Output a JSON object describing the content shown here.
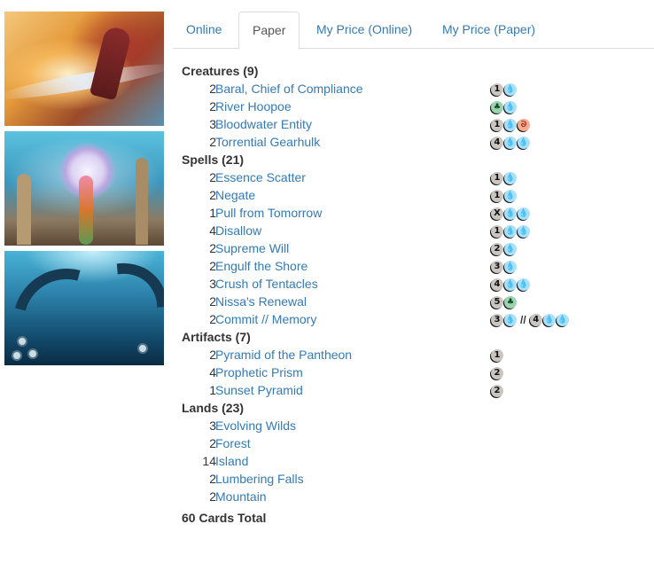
{
  "tabs": [
    {
      "label": "Online",
      "active": false
    },
    {
      "label": "Paper",
      "active": true
    },
    {
      "label": "My Price (Online)",
      "active": false
    },
    {
      "label": "My Price (Paper)",
      "active": false
    }
  ],
  "art": [
    {
      "subject": "red-robed mage casting fire"
    },
    {
      "subject": "glowing orb over city"
    },
    {
      "subject": "giant tentacles under water"
    }
  ],
  "sections": [
    {
      "heading": "Creatures (9)",
      "cards": [
        {
          "qty": "2",
          "name": "Baral, Chief of Compliance",
          "cost": [
            [
              "1",
              "U"
            ]
          ]
        },
        {
          "qty": "2",
          "name": "River Hoopoe",
          "cost": [
            [
              "G",
              "U"
            ]
          ]
        },
        {
          "qty": "3",
          "name": "Bloodwater Entity",
          "cost": [
            [
              "1",
              "U",
              "R"
            ]
          ]
        },
        {
          "qty": "2",
          "name": "Torrential Gearhulk",
          "cost": [
            [
              "4",
              "U",
              "U"
            ]
          ]
        }
      ]
    },
    {
      "heading": "Spells (21)",
      "cards": [
        {
          "qty": "2",
          "name": "Essence Scatter",
          "cost": [
            [
              "1",
              "U"
            ]
          ]
        },
        {
          "qty": "2",
          "name": "Negate",
          "cost": [
            [
              "1",
              "U"
            ]
          ]
        },
        {
          "qty": "1",
          "name": "Pull from Tomorrow",
          "cost": [
            [
              "X",
              "U",
              "U"
            ]
          ]
        },
        {
          "qty": "4",
          "name": "Disallow",
          "cost": [
            [
              "1",
              "U",
              "U"
            ]
          ]
        },
        {
          "qty": "2",
          "name": "Supreme Will",
          "cost": [
            [
              "2",
              "U"
            ]
          ]
        },
        {
          "qty": "2",
          "name": "Engulf the Shore",
          "cost": [
            [
              "3",
              "U"
            ]
          ]
        },
        {
          "qty": "3",
          "name": "Crush of Tentacles",
          "cost": [
            [
              "4",
              "U",
              "U"
            ]
          ]
        },
        {
          "qty": "2",
          "name": "Nissa's Renewal",
          "cost": [
            [
              "5",
              "G"
            ]
          ]
        },
        {
          "qty": "2",
          "name": "Commit // Memory",
          "cost": [
            [
              "3",
              "U"
            ],
            [
              "4",
              "U",
              "U"
            ]
          ]
        }
      ]
    },
    {
      "heading": "Artifacts (7)",
      "cards": [
        {
          "qty": "2",
          "name": "Pyramid of the Pantheon",
          "cost": [
            [
              "1"
            ]
          ]
        },
        {
          "qty": "4",
          "name": "Prophetic Prism",
          "cost": [
            [
              "2"
            ]
          ]
        },
        {
          "qty": "1",
          "name": "Sunset Pyramid",
          "cost": [
            [
              "2"
            ]
          ]
        }
      ]
    },
    {
      "heading": "Lands (23)",
      "cards": [
        {
          "qty": "3",
          "name": "Evolving Wilds",
          "cost": []
        },
        {
          "qty": "2",
          "name": "Forest",
          "cost": []
        },
        {
          "qty": "14",
          "name": "Island",
          "cost": []
        },
        {
          "qty": "2",
          "name": "Lumbering Falls",
          "cost": []
        },
        {
          "qty": "2",
          "name": "Mountain",
          "cost": []
        }
      ]
    }
  ],
  "total": "60 Cards Total",
  "cost_separator": "//",
  "mana_symbols": {
    "U": {
      "glyph": "💧",
      "icon": "blue-mana-icon",
      "color": "#aae0fa"
    },
    "G": {
      "glyph": "♣",
      "icon": "green-mana-icon",
      "color": "#9bd3ae"
    },
    "R": {
      "glyph": "ᘐ",
      "icon": "red-mana-icon",
      "color": "#f9aa8f"
    },
    "generic": {
      "icon": "generic-mana-icon",
      "color": "#cac5c0"
    }
  },
  "colors": {
    "link": "#337ab7",
    "text": "#333333",
    "tab_border": "#dddddd"
  }
}
